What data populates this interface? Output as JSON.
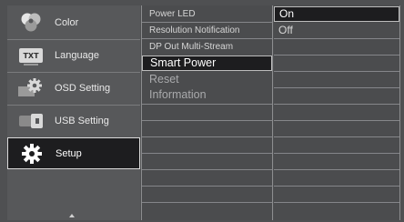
{
  "left_menu": {
    "items": [
      {
        "label": "Color",
        "icon": "color-icon"
      },
      {
        "label": "Language",
        "icon": "language-icon",
        "icon_text": "TXT"
      },
      {
        "label": "OSD Setting",
        "icon": "osd-setting-icon"
      },
      {
        "label": "USB Setting",
        "icon": "usb-setting-icon"
      },
      {
        "label": "Setup",
        "icon": "gear-icon",
        "selected": true
      }
    ]
  },
  "submenu": {
    "items": [
      {
        "label": "Power LED"
      },
      {
        "label": "Resolution Notification"
      },
      {
        "label": "DP Out Multi-Stream"
      },
      {
        "label": "Smart Power",
        "selected": true
      },
      {
        "label": "Reset"
      },
      {
        "label": "Information"
      }
    ]
  },
  "options": {
    "items": [
      {
        "label": "On",
        "selected": true
      },
      {
        "label": "Off"
      }
    ]
  },
  "colors": {
    "background": "#4f5052",
    "selected": "#1d1d1f",
    "text": "#e8e8e8"
  }
}
